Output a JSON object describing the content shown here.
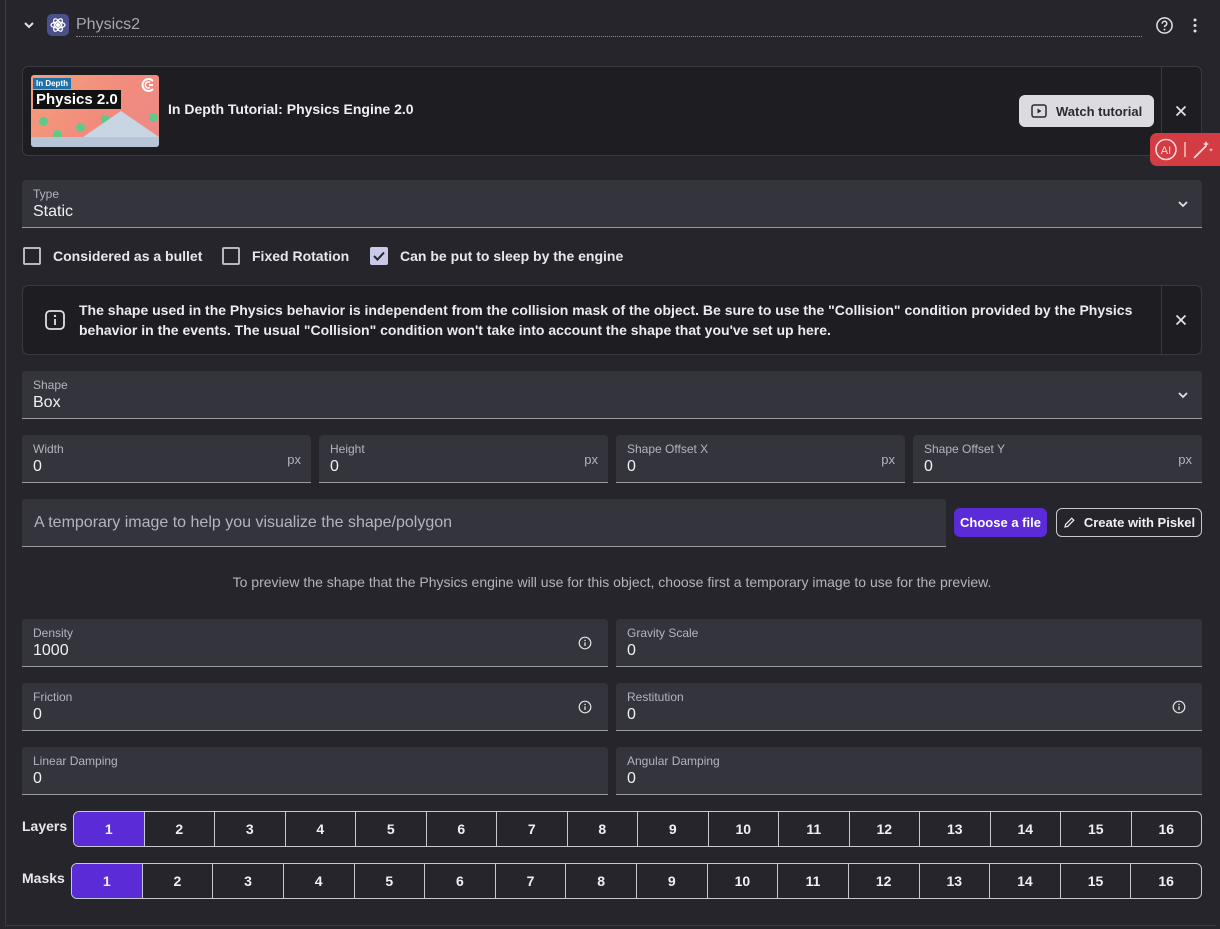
{
  "header": {
    "title": "Physics2"
  },
  "tutorial": {
    "thumb_tag": "In Depth",
    "thumb_title": "Physics 2.0",
    "title": "In Depth Tutorial: Physics Engine 2.0",
    "watch_label": "Watch tutorial"
  },
  "type_field": {
    "label": "Type",
    "value": "Static"
  },
  "checkboxes": [
    {
      "label": "Considered as a bullet",
      "checked": false
    },
    {
      "label": "Fixed Rotation",
      "checked": false
    },
    {
      "label": "Can be put to sleep by the engine",
      "checked": true
    }
  ],
  "alert": {
    "text": "The shape used in the Physics behavior is independent from the collision mask of the object. Be sure to use the \"Collision\" condition provided by the Physics behavior in the events. The usual \"Collision\" condition won't take into account the shape that you've set up here."
  },
  "shape_field": {
    "label": "Shape",
    "value": "Box"
  },
  "dims": {
    "width": {
      "label": "Width",
      "value": "0",
      "unit": "px"
    },
    "height": {
      "label": "Height",
      "value": "0",
      "unit": "px"
    },
    "offset_x": {
      "label": "Shape Offset X",
      "value": "0",
      "unit": "px"
    },
    "offset_y": {
      "label": "Shape Offset Y",
      "value": "0",
      "unit": "px"
    }
  },
  "image_field": {
    "placeholder": "A temporary image to help you visualize the shape/polygon",
    "choose_label": "Choose a file",
    "piskel_label": "Create with Piskel"
  },
  "preview_text": "To preview the shape that the Physics engine will use for this object, choose first a temporary image to use for the preview.",
  "props": {
    "density": {
      "label": "Density",
      "value": "1000"
    },
    "gravity_scale": {
      "label": "Gravity Scale",
      "value": "0"
    },
    "friction": {
      "label": "Friction",
      "value": "0"
    },
    "restitution": {
      "label": "Restitution",
      "value": "0"
    },
    "linear_damping": {
      "label": "Linear Damping",
      "value": "0"
    },
    "angular_damping": {
      "label": "Angular Damping",
      "value": "0"
    }
  },
  "layers": {
    "label": "Layers",
    "items": [
      "1",
      "2",
      "3",
      "4",
      "5",
      "6",
      "7",
      "8",
      "9",
      "10",
      "11",
      "12",
      "13",
      "14",
      "15",
      "16"
    ],
    "selected": "1"
  },
  "masks": {
    "label": "Masks",
    "items": [
      "1",
      "2",
      "3",
      "4",
      "5",
      "6",
      "7",
      "8",
      "9",
      "10",
      "11",
      "12",
      "13",
      "14",
      "15",
      "16"
    ],
    "selected": "1"
  },
  "colors": {
    "accent": "#5a2bd6",
    "ai_tab": "#d43c43"
  }
}
